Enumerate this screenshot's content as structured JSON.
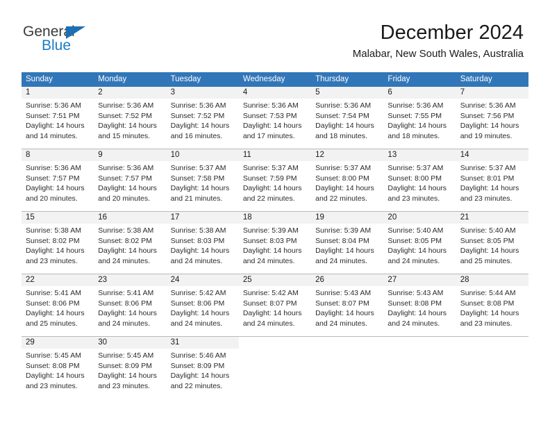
{
  "logo": {
    "primary_text": "General",
    "secondary_text": "Blue",
    "primary_color": "#3a3a3a",
    "secondary_color": "#1a7cc4",
    "triangle_color": "#1a6fb5"
  },
  "header": {
    "title": "December 2024",
    "subtitle": "Malabar, New South Wales, Australia"
  },
  "theme": {
    "header_blue": "#3176b8",
    "daynum_band": "#f2f2f2",
    "grid_line": "#b9b9b9"
  },
  "weekdays": [
    "Sunday",
    "Monday",
    "Tuesday",
    "Wednesday",
    "Thursday",
    "Friday",
    "Saturday"
  ],
  "weeks": [
    [
      {
        "day": "1",
        "lines": [
          "Sunrise: 5:36 AM",
          "Sunset: 7:51 PM",
          "Daylight: 14 hours",
          "and 14 minutes."
        ]
      },
      {
        "day": "2",
        "lines": [
          "Sunrise: 5:36 AM",
          "Sunset: 7:52 PM",
          "Daylight: 14 hours",
          "and 15 minutes."
        ]
      },
      {
        "day": "3",
        "lines": [
          "Sunrise: 5:36 AM",
          "Sunset: 7:52 PM",
          "Daylight: 14 hours",
          "and 16 minutes."
        ]
      },
      {
        "day": "4",
        "lines": [
          "Sunrise: 5:36 AM",
          "Sunset: 7:53 PM",
          "Daylight: 14 hours",
          "and 17 minutes."
        ]
      },
      {
        "day": "5",
        "lines": [
          "Sunrise: 5:36 AM",
          "Sunset: 7:54 PM",
          "Daylight: 14 hours",
          "and 18 minutes."
        ]
      },
      {
        "day": "6",
        "lines": [
          "Sunrise: 5:36 AM",
          "Sunset: 7:55 PM",
          "Daylight: 14 hours",
          "and 18 minutes."
        ]
      },
      {
        "day": "7",
        "lines": [
          "Sunrise: 5:36 AM",
          "Sunset: 7:56 PM",
          "Daylight: 14 hours",
          "and 19 minutes."
        ]
      }
    ],
    [
      {
        "day": "8",
        "lines": [
          "Sunrise: 5:36 AM",
          "Sunset: 7:57 PM",
          "Daylight: 14 hours",
          "and 20 minutes."
        ]
      },
      {
        "day": "9",
        "lines": [
          "Sunrise: 5:36 AM",
          "Sunset: 7:57 PM",
          "Daylight: 14 hours",
          "and 20 minutes."
        ]
      },
      {
        "day": "10",
        "lines": [
          "Sunrise: 5:37 AM",
          "Sunset: 7:58 PM",
          "Daylight: 14 hours",
          "and 21 minutes."
        ]
      },
      {
        "day": "11",
        "lines": [
          "Sunrise: 5:37 AM",
          "Sunset: 7:59 PM",
          "Daylight: 14 hours",
          "and 22 minutes."
        ]
      },
      {
        "day": "12",
        "lines": [
          "Sunrise: 5:37 AM",
          "Sunset: 8:00 PM",
          "Daylight: 14 hours",
          "and 22 minutes."
        ]
      },
      {
        "day": "13",
        "lines": [
          "Sunrise: 5:37 AM",
          "Sunset: 8:00 PM",
          "Daylight: 14 hours",
          "and 23 minutes."
        ]
      },
      {
        "day": "14",
        "lines": [
          "Sunrise: 5:37 AM",
          "Sunset: 8:01 PM",
          "Daylight: 14 hours",
          "and 23 minutes."
        ]
      }
    ],
    [
      {
        "day": "15",
        "lines": [
          "Sunrise: 5:38 AM",
          "Sunset: 8:02 PM",
          "Daylight: 14 hours",
          "and 23 minutes."
        ]
      },
      {
        "day": "16",
        "lines": [
          "Sunrise: 5:38 AM",
          "Sunset: 8:02 PM",
          "Daylight: 14 hours",
          "and 24 minutes."
        ]
      },
      {
        "day": "17",
        "lines": [
          "Sunrise: 5:38 AM",
          "Sunset: 8:03 PM",
          "Daylight: 14 hours",
          "and 24 minutes."
        ]
      },
      {
        "day": "18",
        "lines": [
          "Sunrise: 5:39 AM",
          "Sunset: 8:03 PM",
          "Daylight: 14 hours",
          "and 24 minutes."
        ]
      },
      {
        "day": "19",
        "lines": [
          "Sunrise: 5:39 AM",
          "Sunset: 8:04 PM",
          "Daylight: 14 hours",
          "and 24 minutes."
        ]
      },
      {
        "day": "20",
        "lines": [
          "Sunrise: 5:40 AM",
          "Sunset: 8:05 PM",
          "Daylight: 14 hours",
          "and 24 minutes."
        ]
      },
      {
        "day": "21",
        "lines": [
          "Sunrise: 5:40 AM",
          "Sunset: 8:05 PM",
          "Daylight: 14 hours",
          "and 25 minutes."
        ]
      }
    ],
    [
      {
        "day": "22",
        "lines": [
          "Sunrise: 5:41 AM",
          "Sunset: 8:06 PM",
          "Daylight: 14 hours",
          "and 25 minutes."
        ]
      },
      {
        "day": "23",
        "lines": [
          "Sunrise: 5:41 AM",
          "Sunset: 8:06 PM",
          "Daylight: 14 hours",
          "and 24 minutes."
        ]
      },
      {
        "day": "24",
        "lines": [
          "Sunrise: 5:42 AM",
          "Sunset: 8:06 PM",
          "Daylight: 14 hours",
          "and 24 minutes."
        ]
      },
      {
        "day": "25",
        "lines": [
          "Sunrise: 5:42 AM",
          "Sunset: 8:07 PM",
          "Daylight: 14 hours",
          "and 24 minutes."
        ]
      },
      {
        "day": "26",
        "lines": [
          "Sunrise: 5:43 AM",
          "Sunset: 8:07 PM",
          "Daylight: 14 hours",
          "and 24 minutes."
        ]
      },
      {
        "day": "27",
        "lines": [
          "Sunrise: 5:43 AM",
          "Sunset: 8:08 PM",
          "Daylight: 14 hours",
          "and 24 minutes."
        ]
      },
      {
        "day": "28",
        "lines": [
          "Sunrise: 5:44 AM",
          "Sunset: 8:08 PM",
          "Daylight: 14 hours",
          "and 23 minutes."
        ]
      }
    ],
    [
      {
        "day": "29",
        "lines": [
          "Sunrise: 5:45 AM",
          "Sunset: 8:08 PM",
          "Daylight: 14 hours",
          "and 23 minutes."
        ]
      },
      {
        "day": "30",
        "lines": [
          "Sunrise: 5:45 AM",
          "Sunset: 8:09 PM",
          "Daylight: 14 hours",
          "and 23 minutes."
        ]
      },
      {
        "day": "31",
        "lines": [
          "Sunrise: 5:46 AM",
          "Sunset: 8:09 PM",
          "Daylight: 14 hours",
          "and 22 minutes."
        ]
      },
      {
        "day": "",
        "lines": []
      },
      {
        "day": "",
        "lines": []
      },
      {
        "day": "",
        "lines": []
      },
      {
        "day": "",
        "lines": []
      }
    ]
  ]
}
